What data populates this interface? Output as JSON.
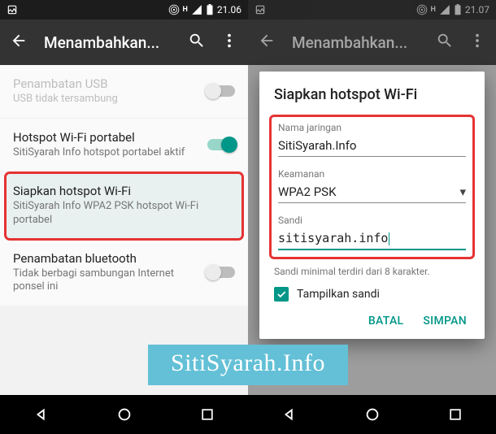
{
  "left": {
    "status": {
      "time": "21.06",
      "network_letter": "H"
    },
    "appbar": {
      "title": "Menambahkan..."
    },
    "rows": {
      "usb": {
        "title": "Penambatan USB",
        "sub": "USB tidak tersambung"
      },
      "wifi": {
        "title": "Hotspot Wi-Fi portabel",
        "sub": "SitiSyarah Info hotspot portabel aktif"
      },
      "setup": {
        "title": "Siapkan hotspot Wi-Fi",
        "sub": "SitiSyarah Info WPA2 PSK hotspot Wi-Fi portabel"
      },
      "bt": {
        "title": "Penambatan bluetooth",
        "sub": "Tidak berbagi sambungan Internet ponsel ini"
      }
    }
  },
  "right": {
    "status": {
      "time": "21.07",
      "network_letter": "H"
    },
    "appbar": {
      "title": "Menambahkan..."
    },
    "dialog": {
      "title": "Siapkan hotspot Wi-Fi",
      "name_label": "Nama jaringan",
      "name_value": "SitiSyarah.Info",
      "sec_label": "Keamanan",
      "sec_value": "WPA2 PSK",
      "pw_label": "Sandi",
      "pw_value": "sitisyarah.info",
      "helper": "Sandi minimal terdiri dari 8 karakter.",
      "show_pw": "Tampilkan sandi",
      "cancel": "BATAL",
      "save": "SIMPAN"
    }
  },
  "watermark": "SitiSyarah.Info"
}
